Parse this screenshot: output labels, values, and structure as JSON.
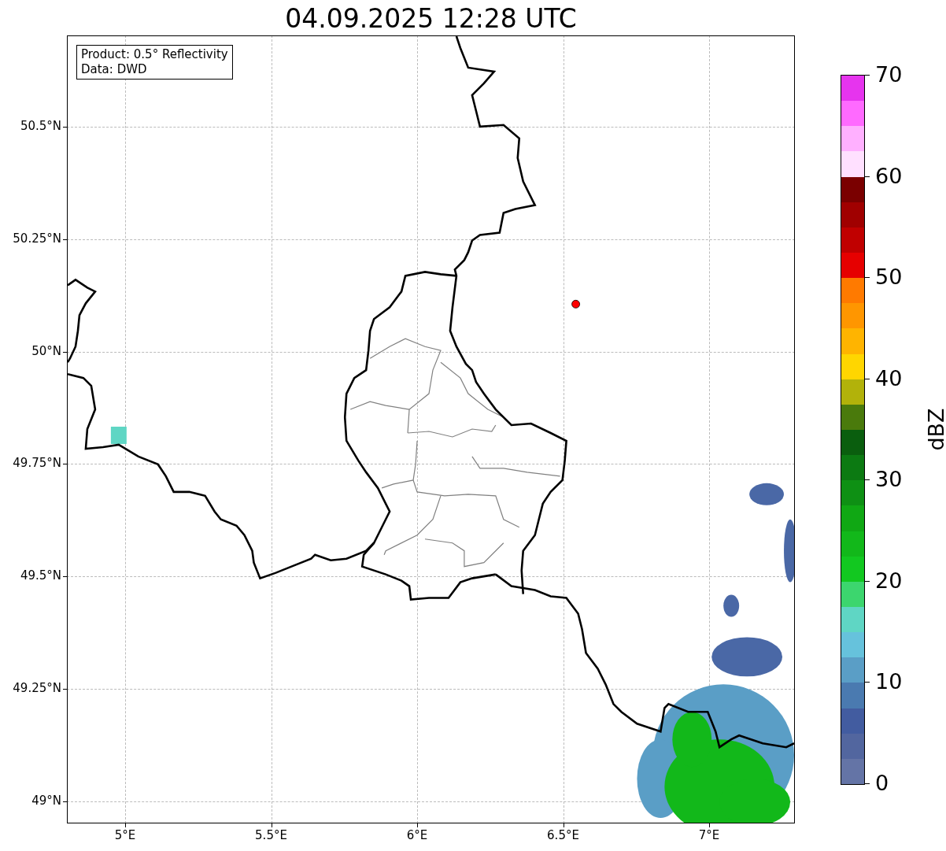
{
  "title": "04.09.2025 12:28 UTC",
  "axes": {
    "xticks": [
      "5°E",
      "5.5°E",
      "6°E",
      "6.5°E",
      "7°E"
    ],
    "yticks": [
      "50.5°N",
      "50.25°N",
      "50°N",
      "49.75°N",
      "49.5°N",
      "49.25°N",
      "49°N"
    ],
    "info": [
      "Product: 0.5° Reflectivity",
      "Data: DWD"
    ]
  },
  "colorbar": {
    "label": "dBZ",
    "ticks": [
      "70",
      "60",
      "50",
      "40",
      "30",
      "20",
      "10",
      "0"
    ],
    "bands": [
      {
        "color": "#6474a6"
      },
      {
        "color": "#52669f"
      },
      {
        "color": "#425ca0"
      },
      {
        "color": "#4a7ab0"
      },
      {
        "color": "#5a9ec6"
      },
      {
        "color": "#66c2dc"
      },
      {
        "color": "#5fd6c4"
      },
      {
        "color": "#3cd66e"
      },
      {
        "color": "#12c820"
      },
      {
        "color": "#12b81a"
      },
      {
        "color": "#10a814"
      },
      {
        "color": "#0e9014"
      },
      {
        "color": "#0c7a12"
      },
      {
        "color": "#0a5e0e"
      },
      {
        "color": "#4a7a0c"
      },
      {
        "color": "#b2b20a"
      },
      {
        "color": "#ffd600"
      },
      {
        "color": "#ffb400"
      },
      {
        "color": "#ff9600"
      },
      {
        "color": "#ff7a00"
      },
      {
        "color": "#e60000"
      },
      {
        "color": "#c00000"
      },
      {
        "color": "#a00000"
      },
      {
        "color": "#7a0000"
      },
      {
        "color": "#ffe0ff"
      },
      {
        "color": "#ffb0ff"
      },
      {
        "color": "#ff6aff"
      },
      {
        "color": "#e634ee"
      }
    ]
  }
}
